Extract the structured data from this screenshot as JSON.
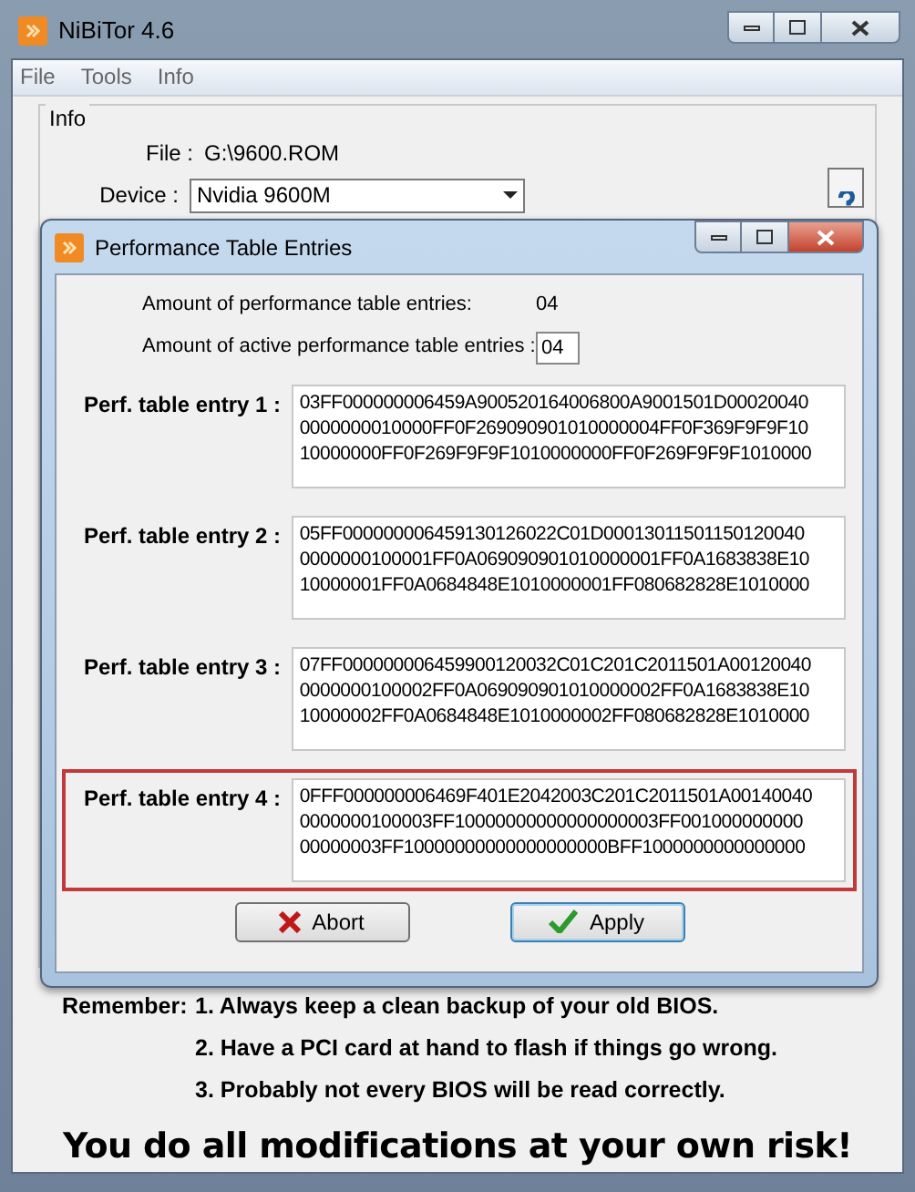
{
  "window": {
    "title": "NiBiTor 4.6"
  },
  "menu": [
    "File",
    "Tools",
    "Info"
  ],
  "info": {
    "title": "Info",
    "file_label": "File :",
    "file_value": "G:\\9600.ROM",
    "device_label": "Device :",
    "device_value": "Nvidia 9600M"
  },
  "dialog": {
    "title": "Performance Table Entries",
    "count_label": "Amount of performance table entries:",
    "count_value": "04",
    "active_label": "Amount of active performance table entries :",
    "active_value": "04",
    "entries": [
      {
        "label": "Perf. table entry 1 :",
        "highlighted": false,
        "lines": [
          "03FF000000006459A900520164006800A9001501D00020040",
          "0000000010000FF0F269090901010000004FF0F369F9F9F10",
          "10000000FF0F269F9F9F1010000000FF0F269F9F9F1010000"
        ]
      },
      {
        "label": "Perf. table entry 2 :",
        "highlighted": false,
        "lines": [
          "05FF000000006459130126022C01D00013011501150120040",
          "0000000100001FF0A069090901010000001FF0A1683838E10",
          "10000001FF0A0684848E1010000001FF080682828E1010000"
        ]
      },
      {
        "label": "Perf. table entry 3 :",
        "highlighted": false,
        "lines": [
          "07FF000000006459900120032C01C201C2011501A00120040",
          "0000000100002FF0A069090901010000002FF0A1683838E10",
          "10000002FF0A0684848E1010000002FF080682828E1010000"
        ]
      },
      {
        "label": "Perf. table entry 4 :",
        "highlighted": true,
        "lines": [
          "0FFF000000006469F401E2042003C201C2011501A00140040",
          "0000000100003FF10000000000000000003FF001000000000",
          "00000003FF10000000000000000000BFF1000000000000000"
        ]
      }
    ],
    "buttons": [
      {
        "kind": "abort",
        "label": "Abort",
        "focused": false
      },
      {
        "kind": "apply",
        "label": "Apply",
        "focused": true
      }
    ]
  },
  "remember": {
    "label": "Remember:",
    "items": [
      "1. Always keep a clean backup of your old BIOS.",
      "2. Have a PCI card at hand to flash if things go wrong.",
      "3. Probably not every BIOS will be read correctly."
    ]
  },
  "warning": "You do all modifications at your own risk!"
}
